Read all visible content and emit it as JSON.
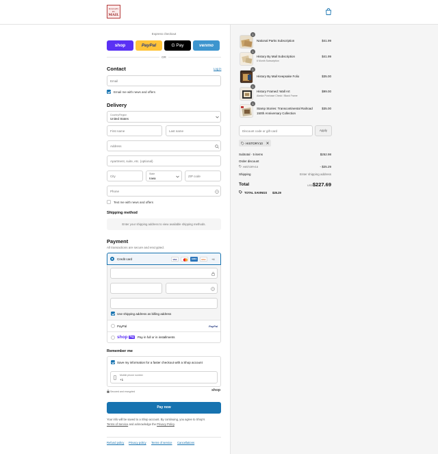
{
  "header": {
    "logo_line1": "HISTORY BY",
    "logo_line2": "MAIL",
    "cart_icon": "shopping-bag-icon"
  },
  "express": {
    "title": "Express checkout",
    "or": "OR",
    "buttons": [
      {
        "label": "shop",
        "color": "#5a31f4"
      },
      {
        "label": "PayPal",
        "color": "#ffc439"
      },
      {
        "label": "G Pay",
        "color": "#000000"
      },
      {
        "label": "venmo",
        "color": "#3d95ce"
      }
    ]
  },
  "contact": {
    "title": "Contact",
    "login": "Log in",
    "email_placeholder": "Email",
    "email_news": "Email me with news and offers"
  },
  "delivery": {
    "title": "Delivery",
    "country_label": "Country/Region",
    "country_value": "United States",
    "first_name": "First name",
    "last_name": "Last name",
    "address": "Address",
    "apartment": "Apartment, suite, etc. (optional)",
    "city": "City",
    "state_label": "State",
    "state_value": "Iowa",
    "zip": "ZIP code",
    "phone": "Phone",
    "text_news": "Text me with news and offers"
  },
  "shipping": {
    "title": "Shipping method",
    "placeholder": "Enter your shipping address to view available shipping methods."
  },
  "payment": {
    "title": "Payment",
    "subtitle": "All transactions are secure and encrypted.",
    "credit_card": "Credit card",
    "card_brands": [
      "VISA",
      "MC",
      "AMEX",
      "DISC"
    ],
    "more_cards": "+4",
    "billing_same": "Use shipping address as billing address",
    "paypal": "PayPal",
    "paypal_logo": "PayPal",
    "shop_pay_logo": "shop",
    "shop_pay_badge": "Pay",
    "shop_pay_text": "Pay in full or in installments"
  },
  "remember": {
    "title": "Remember me",
    "save_info": "Save my information for a faster checkout with a Shop account",
    "phone_label": "Mobile phone number",
    "phone_value": "+1",
    "secure": "Secured and encrypted",
    "shop_logo": "shop"
  },
  "pay_button": "Pay now",
  "disclaimer_line1": "Your info will be saved to a Shop account. By continuing, you agree to Shop's",
  "disclaimer_tos": "Terms of Service",
  "disclaimer_mid": " and acknowledge the ",
  "disclaimer_privacy": "Privacy Policy",
  "disclaimer_end": ".",
  "footer_links": [
    "Refund policy",
    "Privacy policy",
    "Terms of service",
    "Cancellations"
  ],
  "order": {
    "items": [
      {
        "name": "National Parks Subscription",
        "sub": "",
        "price": "$41.99",
        "qty": "1"
      },
      {
        "name": "History By Mail Subscription",
        "sub": "6 Month Subscription",
        "price": "$41.99",
        "qty": "1"
      },
      {
        "name": "History By Mail Keepsake Folio",
        "sub": "",
        "price": "$35.00",
        "qty": "1"
      },
      {
        "name": "History Framed: Wall Art",
        "sub": "Alaska Purchase Check / Black Frame",
        "price": "$99.00",
        "qty": "1"
      },
      {
        "name": "Stamp Stories: Transcontinental Railroad",
        "name2": "150th Anniversary Collection",
        "sub": "",
        "price": "$35.00",
        "qty": "1"
      }
    ],
    "discount_placeholder": "Discount code or gift card",
    "apply": "Apply",
    "code_tag": "HISTORY10",
    "subtotal_label": "Subtotal · 5 items",
    "subtotal_value": "$252.98",
    "order_discount_label": "Order discount",
    "discount_code": "HISTORY10",
    "discount_value": "- $25.29",
    "shipping_label": "Shipping",
    "shipping_value": "Enter shipping address",
    "total_label": "Total",
    "currency": "USD",
    "total_value": "$227.69",
    "savings_label": "TOTAL SAVINGS",
    "savings_value": "$25.29"
  }
}
